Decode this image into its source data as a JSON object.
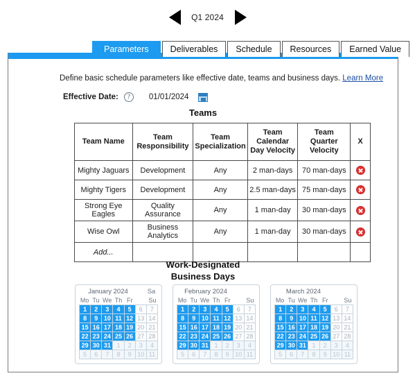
{
  "quarter_nav": {
    "prev_icon": "left-triangle-icon",
    "label": "Q1 2024",
    "next_icon": "right-triangle-icon"
  },
  "tabs": [
    {
      "label": "Parameters",
      "active": true
    },
    {
      "label": "Deliverables",
      "active": false
    },
    {
      "label": "Schedule",
      "active": false
    },
    {
      "label": "Resources",
      "active": false
    },
    {
      "label": "Earned Value",
      "active": false
    }
  ],
  "intro": {
    "text": "Define basic schedule parameters like effective date, teams and business days.",
    "link_label": "Learn More"
  },
  "effective_date": {
    "label": "Effective Date:",
    "help_icon": "question-mark-icon",
    "value": "01/01/2024",
    "calendar_icon": "calendar-picker-icon"
  },
  "teams_section": {
    "title": "Teams",
    "columns": [
      "Team Name",
      "Team Responsibility",
      "Team Specialization",
      "Team Calendar Day Velocity",
      "Team Quarter Velocity",
      "X"
    ],
    "rows": [
      {
        "name": "Mighty Jaguars",
        "responsibility": "Development",
        "specialization": "Any",
        "calendar_day_velocity": "2 man-days",
        "quarter_velocity": "70 man-days",
        "delete_icon": "delete-row-icon"
      },
      {
        "name": "Mighty Tigers",
        "responsibility": "Development",
        "specialization": "Any",
        "calendar_day_velocity": "2.5 man-days",
        "quarter_velocity": "75 man-days",
        "delete_icon": "delete-row-icon"
      },
      {
        "name": "Strong Eye Eagles",
        "responsibility": "Quality Assurance",
        "specialization": "Any",
        "calendar_day_velocity": "1 man-day",
        "quarter_velocity": "30 man-days",
        "delete_icon": "delete-row-icon"
      },
      {
        "name": "Wise Owl",
        "responsibility": "Business Analytics",
        "specialization": "Any",
        "calendar_day_velocity": "1 man-day",
        "quarter_velocity": "30 man-days",
        "delete_icon": "delete-row-icon"
      }
    ],
    "add_row_label": "Add..."
  },
  "business_days": {
    "title_line1": "Work-Designated",
    "title_line2": "Business Days",
    "weekday_headers": [
      "Mo",
      "Tu",
      "We",
      "Th",
      "Fr",
      "Sa",
      "Su"
    ],
    "saturday_header": "Sa",
    "sunday_header": "Su",
    "months": [
      {
        "title": "January 2024",
        "weeks": [
          [
            {
              "d": "1",
              "s": "work"
            },
            {
              "d": "2",
              "s": "work"
            },
            {
              "d": "3",
              "s": "work"
            },
            {
              "d": "4",
              "s": "work"
            },
            {
              "d": "5",
              "s": "work"
            },
            {
              "d": "6",
              "s": "weekend"
            },
            {
              "d": "7",
              "s": "weekend"
            }
          ],
          [
            {
              "d": "8",
              "s": "work"
            },
            {
              "d": "9",
              "s": "work"
            },
            {
              "d": "10",
              "s": "work"
            },
            {
              "d": "11",
              "s": "work"
            },
            {
              "d": "12",
              "s": "work"
            },
            {
              "d": "13",
              "s": "weekend"
            },
            {
              "d": "14",
              "s": "weekend"
            }
          ],
          [
            {
              "d": "15",
              "s": "work"
            },
            {
              "d": "16",
              "s": "work"
            },
            {
              "d": "17",
              "s": "work"
            },
            {
              "d": "18",
              "s": "work"
            },
            {
              "d": "19",
              "s": "work"
            },
            {
              "d": "20",
              "s": "weekend"
            },
            {
              "d": "21",
              "s": "weekend"
            }
          ],
          [
            {
              "d": "22",
              "s": "work"
            },
            {
              "d": "23",
              "s": "work"
            },
            {
              "d": "24",
              "s": "work"
            },
            {
              "d": "25",
              "s": "work"
            },
            {
              "d": "26",
              "s": "work"
            },
            {
              "d": "27",
              "s": "weekend"
            },
            {
              "d": "28",
              "s": "weekend"
            }
          ],
          [
            {
              "d": "29",
              "s": "work"
            },
            {
              "d": "30",
              "s": "work"
            },
            {
              "d": "31",
              "s": "work"
            },
            {
              "d": "1",
              "s": "othermonth"
            },
            {
              "d": "2",
              "s": "othermonth"
            },
            {
              "d": "3",
              "s": "othermonth"
            },
            {
              "d": "4",
              "s": "othermonth"
            }
          ],
          [
            {
              "d": "5",
              "s": "othermonth"
            },
            {
              "d": "6",
              "s": "othermonth"
            },
            {
              "d": "7",
              "s": "othermonth"
            },
            {
              "d": "8",
              "s": "othermonth"
            },
            {
              "d": "9",
              "s": "othermonth"
            },
            {
              "d": "10",
              "s": "othermonth"
            },
            {
              "d": "11",
              "s": "othermonth"
            }
          ]
        ]
      },
      {
        "title": "February 2024",
        "weeks": [
          [
            {
              "d": "1",
              "s": "work"
            },
            {
              "d": "2",
              "s": "work"
            },
            {
              "d": "3",
              "s": "work"
            },
            {
              "d": "4",
              "s": "work"
            },
            {
              "d": "5",
              "s": "work"
            },
            {
              "d": "6",
              "s": "weekend"
            },
            {
              "d": "7",
              "s": "weekend"
            }
          ],
          [
            {
              "d": "8",
              "s": "work"
            },
            {
              "d": "9",
              "s": "work"
            },
            {
              "d": "10",
              "s": "work"
            },
            {
              "d": "11",
              "s": "work"
            },
            {
              "d": "12",
              "s": "work"
            },
            {
              "d": "13",
              "s": "weekend"
            },
            {
              "d": "14",
              "s": "weekend"
            }
          ],
          [
            {
              "d": "15",
              "s": "work"
            },
            {
              "d": "16",
              "s": "work"
            },
            {
              "d": "17",
              "s": "work"
            },
            {
              "d": "18",
              "s": "work"
            },
            {
              "d": "19",
              "s": "work"
            },
            {
              "d": "20",
              "s": "weekend"
            },
            {
              "d": "21",
              "s": "weekend"
            }
          ],
          [
            {
              "d": "22",
              "s": "work"
            },
            {
              "d": "23",
              "s": "work"
            },
            {
              "d": "24",
              "s": "work"
            },
            {
              "d": "25",
              "s": "work"
            },
            {
              "d": "26",
              "s": "work"
            },
            {
              "d": "27",
              "s": "weekend"
            },
            {
              "d": "28",
              "s": "weekend"
            }
          ],
          [
            {
              "d": "29",
              "s": "work"
            },
            {
              "d": "30",
              "s": "work"
            },
            {
              "d": "31",
              "s": "work"
            },
            {
              "d": "1",
              "s": "othermonth"
            },
            {
              "d": "2",
              "s": "othermonth"
            },
            {
              "d": "3",
              "s": "othermonth"
            },
            {
              "d": "4",
              "s": "othermonth"
            }
          ],
          [
            {
              "d": "5",
              "s": "othermonth"
            },
            {
              "d": "6",
              "s": "othermonth"
            },
            {
              "d": "7",
              "s": "othermonth"
            },
            {
              "d": "8",
              "s": "othermonth"
            },
            {
              "d": "9",
              "s": "othermonth"
            },
            {
              "d": "10",
              "s": "othermonth"
            },
            {
              "d": "11",
              "s": "othermonth"
            }
          ]
        ]
      },
      {
        "title": "March 2024",
        "weeks": [
          [
            {
              "d": "1",
              "s": "work"
            },
            {
              "d": "2",
              "s": "work"
            },
            {
              "d": "3",
              "s": "work"
            },
            {
              "d": "4",
              "s": "work"
            },
            {
              "d": "5",
              "s": "work"
            },
            {
              "d": "6",
              "s": "weekend"
            },
            {
              "d": "7",
              "s": "weekend"
            }
          ],
          [
            {
              "d": "8",
              "s": "work"
            },
            {
              "d": "9",
              "s": "work"
            },
            {
              "d": "10",
              "s": "work"
            },
            {
              "d": "11",
              "s": "work"
            },
            {
              "d": "12",
              "s": "work"
            },
            {
              "d": "13",
              "s": "weekend"
            },
            {
              "d": "14",
              "s": "weekend"
            }
          ],
          [
            {
              "d": "15",
              "s": "work"
            },
            {
              "d": "16",
              "s": "work"
            },
            {
              "d": "17",
              "s": "work"
            },
            {
              "d": "18",
              "s": "work"
            },
            {
              "d": "19",
              "s": "work"
            },
            {
              "d": "20",
              "s": "weekend"
            },
            {
              "d": "21",
              "s": "weekend"
            }
          ],
          [
            {
              "d": "22",
              "s": "work"
            },
            {
              "d": "23",
              "s": "work"
            },
            {
              "d": "24",
              "s": "work"
            },
            {
              "d": "25",
              "s": "work"
            },
            {
              "d": "26",
              "s": "work"
            },
            {
              "d": "27",
              "s": "weekend"
            },
            {
              "d": "28",
              "s": "weekend"
            }
          ],
          [
            {
              "d": "29",
              "s": "work"
            },
            {
              "d": "30",
              "s": "work"
            },
            {
              "d": "31",
              "s": "work"
            },
            {
              "d": "1",
              "s": "othermonth"
            },
            {
              "d": "2",
              "s": "othermonth"
            },
            {
              "d": "3",
              "s": "othermonth"
            },
            {
              "d": "4",
              "s": "othermonth"
            }
          ],
          [
            {
              "d": "5",
              "s": "othermonth"
            },
            {
              "d": "6",
              "s": "othermonth"
            },
            {
              "d": "7",
              "s": "othermonth"
            },
            {
              "d": "8",
              "s": "othermonth"
            },
            {
              "d": "9",
              "s": "othermonth"
            },
            {
              "d": "10",
              "s": "othermonth"
            },
            {
              "d": "11",
              "s": "othermonth"
            }
          ]
        ]
      }
    ]
  },
  "colors": {
    "accent_blue": "#1c9bf0",
    "delete_red": "#e03131",
    "link_blue": "#1b4ea3"
  }
}
